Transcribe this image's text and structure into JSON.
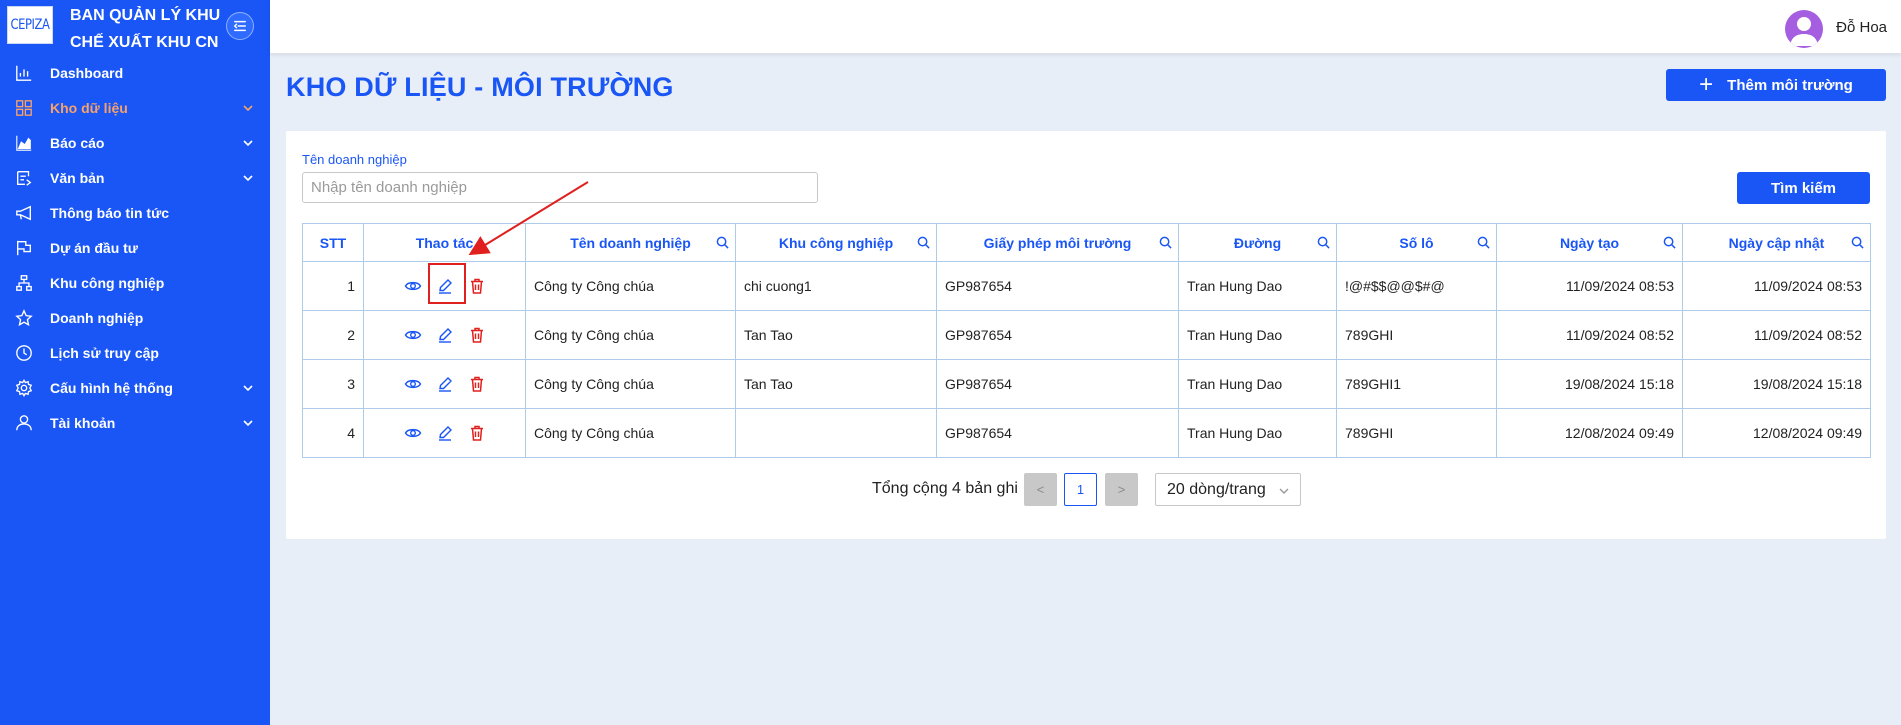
{
  "app": {
    "logo_text": "CEPIZA",
    "title_line1": "BAN QUẢN LÝ KHU",
    "title_line2": "CHẾ XUẤT KHU CN"
  },
  "sidebar": {
    "items": [
      {
        "label": "Dashboard",
        "icon": "bar-chart-icon",
        "expandable": false
      },
      {
        "label": "Kho dữ liệu",
        "icon": "grid-icon",
        "expandable": true,
        "active": true
      },
      {
        "label": "Báo cáo",
        "icon": "area-chart-icon",
        "expandable": true
      },
      {
        "label": "Văn bản",
        "icon": "document-icon",
        "expandable": true
      },
      {
        "label": "Thông báo tin tức",
        "icon": "megaphone-icon",
        "expandable": false
      },
      {
        "label": "Dự án đầu tư",
        "icon": "flag-icon",
        "expandable": false
      },
      {
        "label": "Khu công nghiệp",
        "icon": "sitemap-icon",
        "expandable": false
      },
      {
        "label": "Doanh nghiệp",
        "icon": "star-icon",
        "expandable": false
      },
      {
        "label": "Lịch sử truy cập",
        "icon": "clock-icon",
        "expandable": false
      },
      {
        "label": "Cấu hình hệ thống",
        "icon": "gear-icon",
        "expandable": true
      },
      {
        "label": "Tài khoản",
        "icon": "user-icon",
        "expandable": true
      }
    ],
    "active_color": "#f7a26a"
  },
  "topbar": {
    "username": "Đỗ Hoa"
  },
  "page": {
    "title": "KHO DỮ LIỆU - MÔI TRƯỜNG",
    "add_button": "Thêm môi trường"
  },
  "filter": {
    "label": "Tên doanh nghiệp",
    "placeholder": "Nhập tên doanh nghiệp",
    "value": "",
    "search_button": "Tìm kiếm"
  },
  "table": {
    "columns": [
      "STT",
      "Thao tác",
      "Tên doanh nghiệp",
      "Khu công nghiệp",
      "Giấy phép môi trường",
      "Đường",
      "Số lô",
      "Ngày tạo",
      "Ngày cập nhật"
    ],
    "rows": [
      {
        "stt": "1",
        "company": "Công ty Công chúa",
        "zone": "chi cuong1",
        "license": "GP987654",
        "street": "Tran Hung Dao",
        "lot": "!@#$$@@$#@",
        "created": "11/09/2024 08:53",
        "updated": "11/09/2024 08:53"
      },
      {
        "stt": "2",
        "company": "Công ty Công chúa",
        "zone": "Tan Tao",
        "license": "GP987654",
        "street": "Tran Hung Dao",
        "lot": "789GHI",
        "created": "11/09/2024 08:52",
        "updated": "11/09/2024 08:52"
      },
      {
        "stt": "3",
        "company": "Công ty Công chúa",
        "zone": "Tan Tao",
        "license": "GP987654",
        "street": "Tran Hung Dao",
        "lot": "789GHI1",
        "created": "19/08/2024 15:18",
        "updated": "19/08/2024 15:18"
      },
      {
        "stt": "4",
        "company": "Công ty Công chúa",
        "zone": "",
        "license": "GP987654",
        "street": "Tran Hung Dao",
        "lot": "789GHI",
        "created": "12/08/2024 09:49",
        "updated": "12/08/2024 09:49"
      }
    ]
  },
  "pagination": {
    "total_text": "Tổng cộng 4 bản ghi",
    "prev": "<",
    "current_page": "1",
    "next": ">",
    "page_size": "20 dòng/trang"
  },
  "colors": {
    "primary": "#1a56f5",
    "danger": "#e0201e",
    "background": "#e8eef7"
  }
}
